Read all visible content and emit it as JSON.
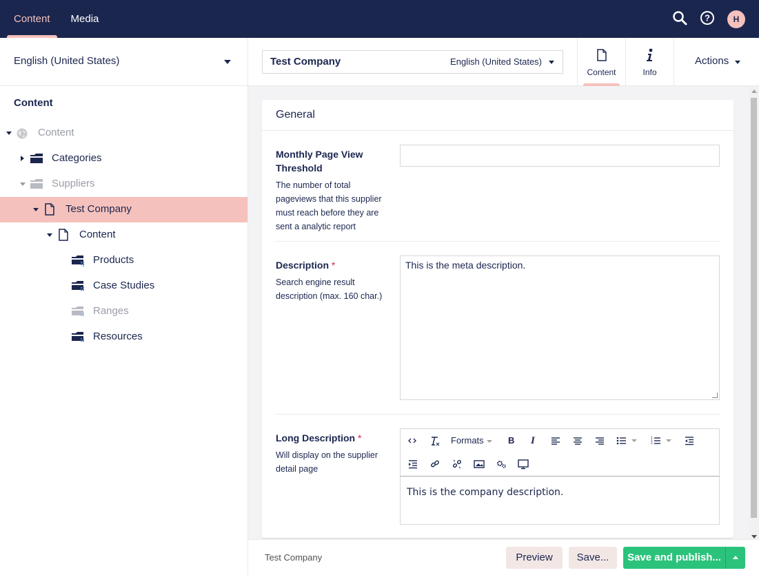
{
  "topnav": {
    "sections": [
      {
        "label": "Content",
        "active": true
      },
      {
        "label": "Media",
        "active": false
      }
    ],
    "user_initial": "H",
    "icons": [
      "search-icon",
      "help-icon"
    ]
  },
  "sidebar": {
    "language": "English (United States)",
    "heading": "Content",
    "tree": [
      {
        "label": "Content",
        "icon": "globe-icon",
        "muted": true
      },
      {
        "label": "Categories",
        "icon": "folder-icon",
        "muted": false
      },
      {
        "label": "Suppliers",
        "icon": "folder-icon",
        "muted": true
      },
      {
        "label": "Test Company",
        "icon": "document-icon",
        "selected": true
      },
      {
        "label": "Content",
        "icon": "document-icon",
        "muted": false
      },
      {
        "label": "Products",
        "icon": "folder-grid-icon",
        "muted": false
      },
      {
        "label": "Case Studies",
        "icon": "folder-grid-icon",
        "muted": false
      },
      {
        "label": "Ranges",
        "icon": "folder-grid-icon",
        "muted": true
      },
      {
        "label": "Resources",
        "icon": "folder-grid-icon",
        "muted": false
      }
    ]
  },
  "editor": {
    "name": "Test Company",
    "variant": "English (United States)",
    "apps": [
      {
        "label": "Content",
        "icon": "document-icon",
        "active": true
      },
      {
        "label": "Info",
        "icon": "info-icon",
        "active": false
      }
    ],
    "actions_label": "Actions"
  },
  "group": {
    "title": "General",
    "properties": {
      "threshold": {
        "label": "Monthly Page View Threshold",
        "description": "The number of total pageviews that this supplier must reach before they are sent a analytic report",
        "value": ""
      },
      "description": {
        "label": "Description",
        "required_mark": "*",
        "description": "Search engine result description (max. 160 char.)",
        "value": "This is the meta description."
      },
      "long_description": {
        "label": "Long Description",
        "required_mark": "*",
        "description": "Will display on the supplier detail page",
        "value": "This is the company description.",
        "toolbar": {
          "formats_label": "Formats"
        }
      }
    }
  },
  "footer": {
    "breadcrumb": "Test Company",
    "preview_label": "Preview",
    "save_label": "Save...",
    "publish_label": "Save and publish..."
  },
  "colors": {
    "navy": "#1b264f",
    "accent_pink": "#f5c1bc",
    "green": "#2bc37c",
    "required": "#d42054"
  }
}
